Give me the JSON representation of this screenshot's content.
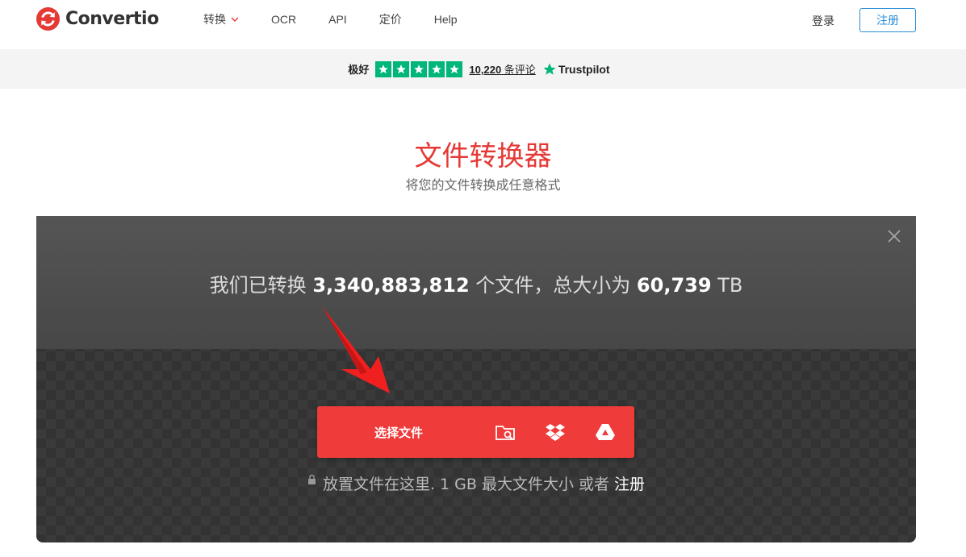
{
  "header": {
    "logo_text": "Convertio",
    "nav": [
      {
        "label": "转换",
        "has_dropdown": true
      },
      {
        "label": "OCR"
      },
      {
        "label": "API"
      },
      {
        "label": "定价"
      },
      {
        "label": "Help"
      }
    ],
    "login_label": "登录",
    "signup_label": "注册"
  },
  "trustbar": {
    "rating_label": "极好",
    "stars": 5,
    "review_count": "10,220",
    "review_suffix": " 条评论",
    "brand": "Trustpilot"
  },
  "hero": {
    "title": "文件转换器",
    "subtitle": "将您的文件转换成任意格式"
  },
  "panel": {
    "stats_prefix": "我们已转换 ",
    "files_count": "3,340,883,812",
    "stats_mid": " 个文件，总大小为 ",
    "total_size": "60,739",
    "size_unit": " TB",
    "choose_label": "选择文件",
    "sources": [
      "folder-search-icon",
      "dropbox-icon",
      "google-drive-icon"
    ],
    "drop_text": "放置文件在这里. 1 GB 最大文件大小 或者 ",
    "drop_link": "注册"
  },
  "colors": {
    "brand_red": "#e53935",
    "button_red": "#f03b3b",
    "signup_blue": "#2a8fd8",
    "trustpilot_green": "#00b67a"
  }
}
